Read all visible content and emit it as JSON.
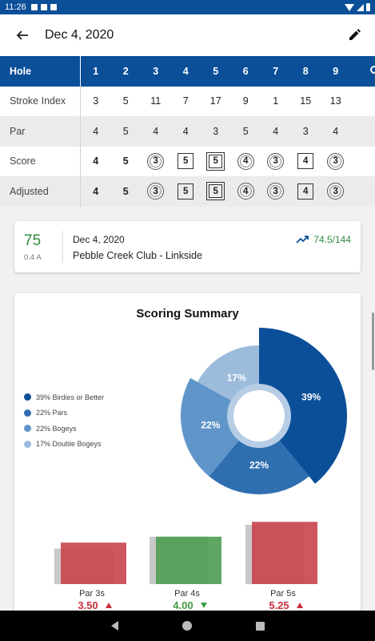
{
  "status": {
    "time": "11:26"
  },
  "appbar": {
    "title": "Dec 4, 2020"
  },
  "table": {
    "header_label": "Hole",
    "holes": [
      "1",
      "2",
      "3",
      "4",
      "5",
      "6",
      "7",
      "8",
      "9"
    ],
    "stroke_index_label": "Stroke Index",
    "stroke_index": [
      "3",
      "5",
      "11",
      "7",
      "17",
      "9",
      "1",
      "15",
      "13"
    ],
    "par_label": "Par",
    "par": [
      "4",
      "5",
      "4",
      "4",
      "3",
      "5",
      "4",
      "3",
      "4"
    ],
    "score_label": "Score",
    "score": [
      "4",
      "5",
      "3",
      "5",
      "5",
      "4",
      "3",
      "4",
      "3"
    ],
    "adjusted_label": "Adjusted",
    "adjusted": [
      "4",
      "5",
      "3",
      "5",
      "5",
      "4",
      "3",
      "4",
      "3"
    ]
  },
  "round": {
    "score": "75",
    "sub": "0.4 A",
    "date": "Dec 4, 2020",
    "course": "Pebble Creek Club - Linkside",
    "trend": "74.5/144"
  },
  "summary": {
    "title": "Scoring Summary",
    "legend": [
      {
        "label": "39% Birdies or Better",
        "color": "#0b4f99"
      },
      {
        "label": "22% Pars",
        "color": "#2f6fb0"
      },
      {
        "label": "22% Bogeys",
        "color": "#5f95c9"
      },
      {
        "label": "17% Double Bogeys",
        "color": "#9dbcdc"
      }
    ]
  },
  "chart_data": [
    {
      "type": "pie",
      "title": "Scoring Summary",
      "labels": [
        "39% Birdies or Better",
        "22% Pars",
        "22% Bogeys",
        "17% Double Bogeys"
      ],
      "values": [
        39,
        22,
        22,
        17
      ],
      "slice_labels": [
        "39%",
        "22%",
        "22%",
        "17%"
      ],
      "colors": [
        "#0b4f99",
        "#2f6fb0",
        "#5f95c9",
        "#9dbcdc"
      ]
    },
    {
      "type": "bar",
      "categories": [
        "Par 3s",
        "Par 4s",
        "Par 5s"
      ],
      "values": [
        3.5,
        4.0,
        5.25
      ],
      "value_labels": [
        "3.50",
        "4.00",
        "5.25"
      ],
      "par": [
        3,
        4,
        5
      ],
      "colors": [
        "#c8444e",
        "#4f9d52",
        "#c8444e"
      ],
      "trend": [
        "up",
        "down",
        "up"
      ]
    }
  ]
}
